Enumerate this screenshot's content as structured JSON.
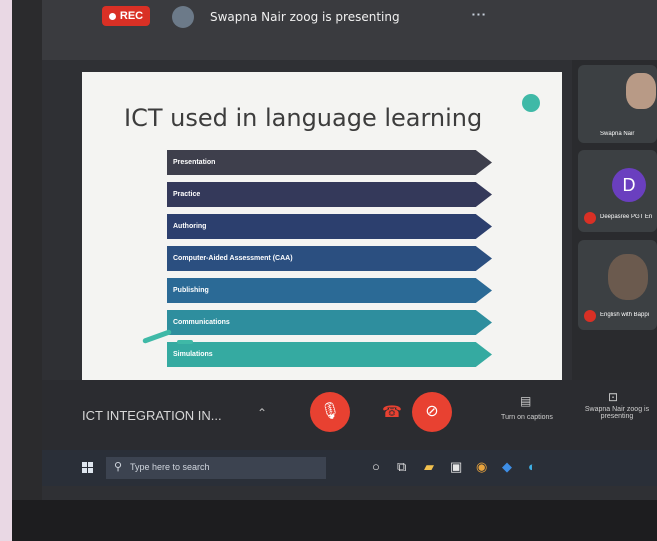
{
  "meet": {
    "rec_label": "REC",
    "presenting_text": "Swapna Nair zoog is presenting",
    "meeting_name": "ICT INTEGRATION IN...",
    "turn_on_captions": "Turn on captions",
    "presentation_label": "Swapna Nair zoog is presenting"
  },
  "slide": {
    "title": "ICT used in language learning",
    "items": [
      {
        "label": "Presentation",
        "color": "#3e3f4c"
      },
      {
        "label": "Practice",
        "color": "#34395a"
      },
      {
        "label": "Authoring",
        "color": "#2c3f6e"
      },
      {
        "label": "Computer-Aided Assessment (CAA)",
        "color": "#2b4f80"
      },
      {
        "label": "Publishing",
        "color": "#2b6a96"
      },
      {
        "label": "Communications",
        "color": "#2e8e9e"
      },
      {
        "label": "Simulations",
        "color": "#35aaa1"
      }
    ]
  },
  "participants": [
    {
      "name": "Swapna Nair",
      "avatar": "photo"
    },
    {
      "name": "Deepasree PGT En",
      "avatar_letter": "D"
    },
    {
      "name": "English with Bappi",
      "avatar": "photo"
    }
  ],
  "taskbar": {
    "search_placeholder": "Type here to search"
  },
  "colors": {
    "accent_red": "#e84131",
    "rec_red": "#d93025",
    "teal": "#3fb9a7"
  }
}
